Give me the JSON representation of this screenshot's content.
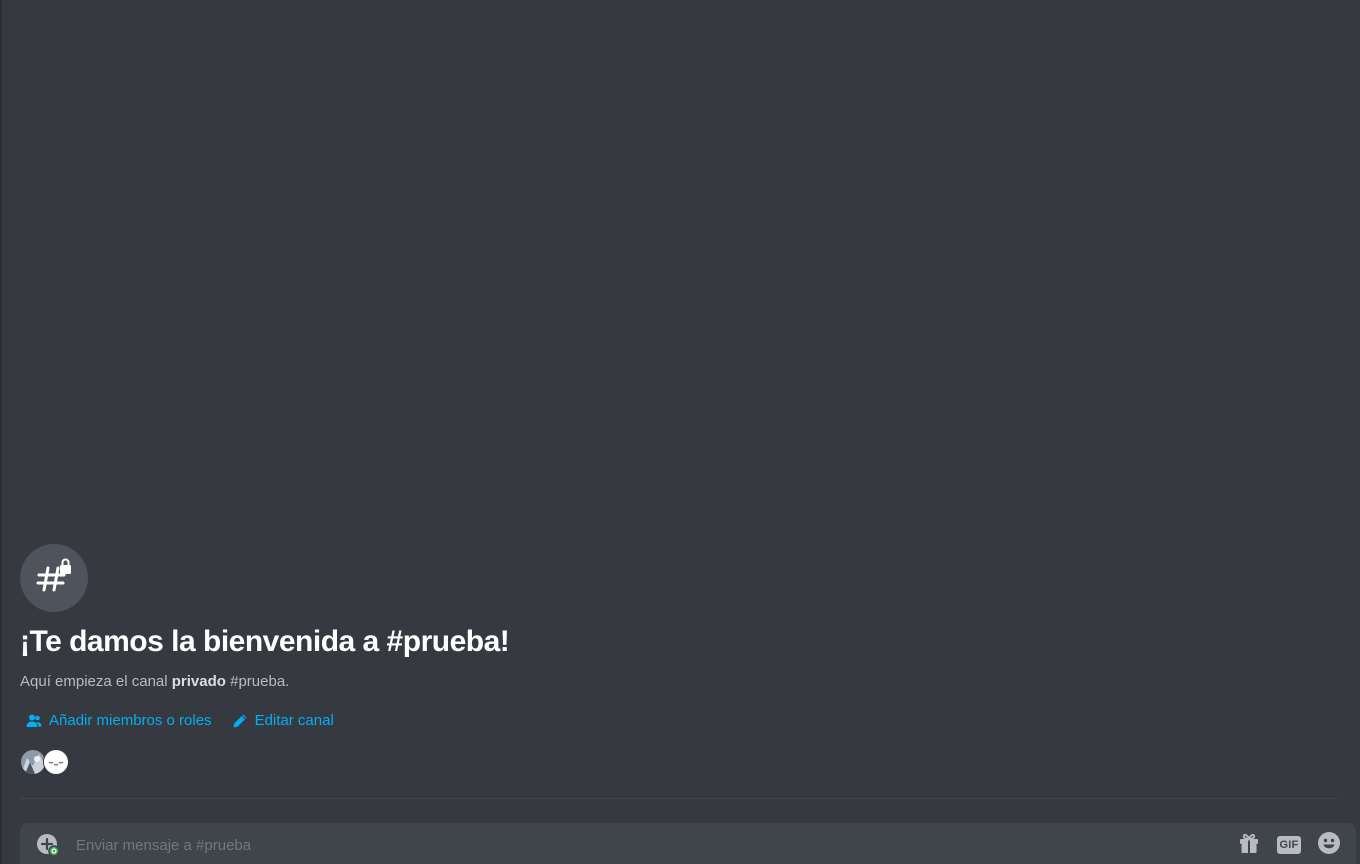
{
  "welcome": {
    "icon": "hashtag-lock-icon",
    "title": "¡Te damos la bienvenida a #prueba!",
    "desc_prefix": "Aquí empieza el canal ",
    "desc_bold": "privado",
    "desc_suffix": " #prueba."
  },
  "actions": {
    "add_members_label": "Añadir miembros o roles",
    "add_members_icon": "person-add-icon",
    "edit_channel_label": "Editar canal",
    "edit_channel_icon": "pencil-icon"
  },
  "members": {
    "avatars": [
      "member-avatar-1",
      "member-avatar-2"
    ]
  },
  "composer": {
    "placeholder": "Enviar mensaje a #prueba",
    "attach_icon": "plus-circle-icon",
    "gift_icon": "gift-icon",
    "gif_label": "GIF",
    "emoji_icon": "smiley-icon"
  },
  "colors": {
    "background": "#36393f",
    "composer_bg": "#40444b",
    "link": "#00aff4",
    "title": "#ffffff",
    "muted_text": "#b9bbbe"
  }
}
